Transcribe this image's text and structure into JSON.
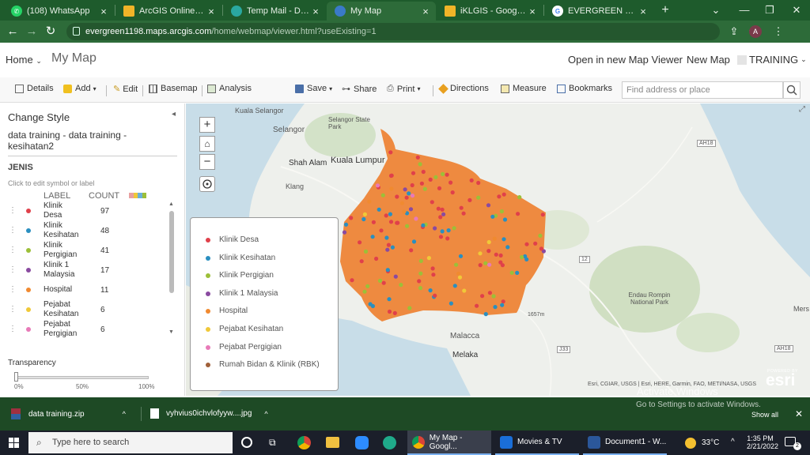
{
  "browser": {
    "tabs": [
      {
        "title": "(108) WhatsApp",
        "icon": "whatsapp-icon"
      },
      {
        "title": "ArcGIS Online-UTM - ...",
        "icon": "arcgis-icon"
      },
      {
        "title": "Temp Mail - Disposab...",
        "icon": "tempmail-icon"
      },
      {
        "title": "My Map",
        "icon": "map-icon"
      },
      {
        "title": "iKLGIS - Google Drive",
        "icon": "drive-icon"
      },
      {
        "title": "EVERGREEN RESOURC...",
        "icon": "google-icon"
      }
    ],
    "url_host": "evergreen1198.maps.arcgis.com",
    "url_path": "/home/webmap/viewer.html?useExisting=1",
    "profile_initial": "A"
  },
  "app_header": {
    "home": "Home",
    "map_title": "My Map",
    "open_viewer": "Open in new Map Viewer",
    "new_map": "New Map",
    "account": "TRAINING"
  },
  "toolbar": {
    "details": "Details",
    "add": "Add",
    "edit": "Edit",
    "basemap": "Basemap",
    "analysis": "Analysis",
    "save": "Save",
    "share": "Share",
    "print": "Print",
    "directions": "Directions",
    "measure": "Measure",
    "bookmarks": "Bookmarks",
    "search_placeholder": "Find address or place"
  },
  "sidebar": {
    "heading": "Change Style",
    "layer_line1": "data training - data training -",
    "layer_line2": "kesihatan2",
    "field": "JENIS",
    "hint": "Click to edit symbol or label",
    "col_label": "LABEL",
    "col_count": "COUNT",
    "items": [
      {
        "label1": "Klinik",
        "label2": "Desa",
        "count": "97",
        "color": "#e0404a"
      },
      {
        "label1": "Klinik",
        "label2": "Kesihatan",
        "count": "48",
        "color": "#2a8fc0"
      },
      {
        "label1": "Klinik",
        "label2": "Pergigian",
        "count": "41",
        "color": "#9cbf38"
      },
      {
        "label1": "Klinik 1",
        "label2": "Malaysia",
        "count": "17",
        "color": "#8a4aa0"
      },
      {
        "label1": "Hospital",
        "label2": "",
        "count": "11",
        "color": "#f08a30"
      },
      {
        "label1": "Pejabat",
        "label2": "Kesihatan",
        "count": "6",
        "color": "#f0c838"
      },
      {
        "label1": "Pejabat",
        "label2": "Pergigian",
        "count": "6",
        "color": "#e87ab8"
      }
    ],
    "transparency_label": "Transparency",
    "transparency_ticks": [
      "0%",
      "50%",
      "100%"
    ],
    "transparency_value": 0
  },
  "map": {
    "labels": {
      "kuala_selangor": "Kuala Selangor",
      "selangor_state_park": "Selangor State Park",
      "selangor": "Selangor",
      "shah_alam": "Shah Alam",
      "kuala_lumpur": "Kuala Lumpur",
      "klang": "Klang",
      "malacca": "Malacca",
      "melaka": "Melaka",
      "endau": "Endau Rompin National Park",
      "mersing": "Mers",
      "ah18_a": "AH18",
      "ah18_b": "AH18",
      "r12": "12",
      "r33": "J33",
      "elev": "1657m",
      "attribution": "Esri, CGIAR, USGS | Esri, HERE, Garmin, FAO, METI/NASA, USGS",
      "esri": "esri",
      "esri_small": "POWERED BY",
      "watermark": "Activate Windows",
      "watermark_sub": "Go to Settings to activate Windows."
    },
    "polygon_color": "#ee8a40"
  },
  "legend_popup": {
    "items": [
      {
        "label": "Klinik Desa",
        "color": "#e0404a"
      },
      {
        "label": "Klinik Kesihatan",
        "color": "#2a8fc0"
      },
      {
        "label": "Klinik Pergigian",
        "color": "#9cbf38"
      },
      {
        "label": "Klinik 1 Malaysia",
        "color": "#8a4aa0"
      },
      {
        "label": "Hospital",
        "color": "#f08a30"
      },
      {
        "label": "Pejabat Kesihatan",
        "color": "#f0c838"
      },
      {
        "label": "Pejabat Pergigian",
        "color": "#e87ab8"
      },
      {
        "label": "Rumah Bidan & Klinik (RBK)",
        "color": "#a0603a"
      }
    ]
  },
  "downloads": {
    "file1": "data training.zip",
    "file2": "vyhvius0ichvlofyyw....jpg",
    "show_all": "Show all"
  },
  "taskbar": {
    "search_placeholder": "Type here to search",
    "apps": [
      {
        "label": "My Map - Googl...",
        "icon": "chrome-icon"
      },
      {
        "label": "Movies & TV",
        "icon": "movies-icon"
      },
      {
        "label": "Document1 - W...",
        "icon": "word-icon"
      }
    ],
    "weather": "33°C",
    "time": "1:35 PM",
    "date": "2/21/2022",
    "notifications": "2"
  }
}
